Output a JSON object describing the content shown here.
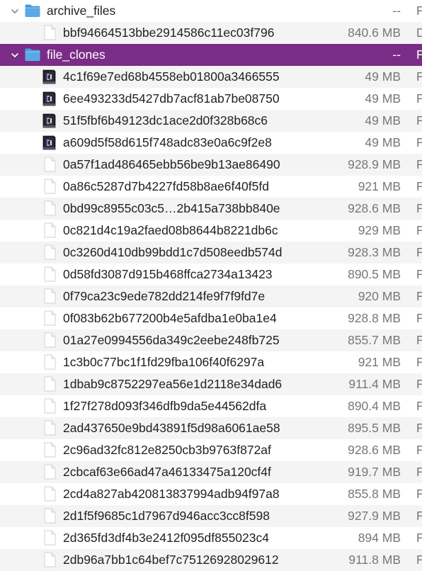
{
  "folders": [
    {
      "name": "archive_files",
      "size": "--",
      "kind": "F",
      "expanded": true,
      "selected": false,
      "files": [
        {
          "name": "bbf94664513bbe2914586c11ec03f796",
          "size": "840.6 MB",
          "kind": "D",
          "icon": "document-icon"
        }
      ]
    },
    {
      "name": "file_clones",
      "size": "--",
      "kind": "F",
      "expanded": true,
      "selected": true,
      "files": [
        {
          "name": "4c1f69e7ed68b4558eb01800a3466555",
          "size": "49 MB",
          "kind": "F",
          "icon": "executable-icon"
        },
        {
          "name": "6ee493233d5427db7acf81ab7be08750",
          "size": "49 MB",
          "kind": "F",
          "icon": "executable-icon"
        },
        {
          "name": "51f5fbf6b49123dc1ace2d0f328b68c6",
          "size": "49 MB",
          "kind": "F",
          "icon": "executable-icon"
        },
        {
          "name": "a609d5f58d615f748adc83e0a6c9f2e8",
          "size": "49 MB",
          "kind": "F",
          "icon": "executable-icon"
        },
        {
          "name": "0a57f1ad486465ebb56be9b13ae86490",
          "size": "928.9 MB",
          "kind": "F",
          "icon": "document-icon"
        },
        {
          "name": "0a86c5287d7b4227fd58b8ae6f40f5fd",
          "size": "921 MB",
          "kind": "F",
          "icon": "document-icon"
        },
        {
          "name": "0bd99c8955c03c5…2b415a738bb840e",
          "size": "928.6 MB",
          "kind": "F",
          "icon": "document-icon"
        },
        {
          "name": "0c821d4c19a2faed08b8644b8221db6c",
          "size": "929 MB",
          "kind": "F",
          "icon": "document-icon"
        },
        {
          "name": "0c3260d410db99bdd1c7d508eedb574d",
          "size": "928.3 MB",
          "kind": "F",
          "icon": "document-icon"
        },
        {
          "name": "0d58fd3087d915b468ffca2734a13423",
          "size": "890.5 MB",
          "kind": "F",
          "icon": "document-icon"
        },
        {
          "name": "0f79ca23c9ede782dd214fe9f7f9fd7e",
          "size": "920 MB",
          "kind": "F",
          "icon": "document-icon"
        },
        {
          "name": "0f083b62b677200b4e5afdba1e0ba1e4",
          "size": "928.8 MB",
          "kind": "F",
          "icon": "document-icon"
        },
        {
          "name": "01a27e0994556da349c2eebe248fb725",
          "size": "855.7 MB",
          "kind": "F",
          "icon": "document-icon"
        },
        {
          "name": "1c3b0c77bc1f1fd29fba106f40f6297a",
          "size": "921 MB",
          "kind": "F",
          "icon": "document-icon"
        },
        {
          "name": "1dbab9c8752297ea56e1d2118e34dad6",
          "size": "911.4 MB",
          "kind": "F",
          "icon": "document-icon"
        },
        {
          "name": "1f27f278d093f346dfb9da5e44562dfa",
          "size": "890.4 MB",
          "kind": "F",
          "icon": "document-icon"
        },
        {
          "name": "2ad437650e9bd43891f5d98a6061ae58",
          "size": "895.5 MB",
          "kind": "F",
          "icon": "document-icon"
        },
        {
          "name": "2c96ad32fc812e8250cb3b9763f872af",
          "size": "928.6 MB",
          "kind": "F",
          "icon": "document-icon"
        },
        {
          "name": "2cbcaf63e66ad47a46133475a120cf4f",
          "size": "919.7 MB",
          "kind": "F",
          "icon": "document-icon"
        },
        {
          "name": "2cd4a827ab420813837994adb94f97a8",
          "size": "855.8 MB",
          "kind": "F",
          "icon": "document-icon"
        },
        {
          "name": "2d1f5f9685c1d7967d946acc3cc8f598",
          "size": "927.9 MB",
          "kind": "F",
          "icon": "document-icon"
        },
        {
          "name": "2d365fd3df4b3e2412f095df855023c4",
          "size": "894 MB",
          "kind": "F",
          "icon": "document-icon"
        },
        {
          "name": "2db96a7bb1c64bef7c75126928029612",
          "size": "911.8 MB",
          "kind": "F",
          "icon": "document-icon"
        }
      ]
    }
  ],
  "colors": {
    "selection": "#7a2d86",
    "stripe": "#f4f4f4",
    "folder": "#5aa9e6",
    "secondary_text": "#777777"
  }
}
